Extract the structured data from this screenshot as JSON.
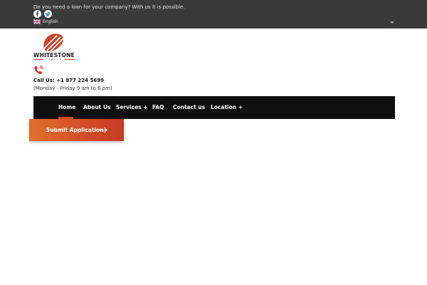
{
  "topbar": {
    "tagline": "Do you need a loan for your company? With us it is possible.",
    "social": [
      {
        "icon": "facebook-icon"
      },
      {
        "icon": "twitter-icon"
      }
    ],
    "language": {
      "flag_icon": "uk-flag-icon",
      "label": "English",
      "chevron_icon": "chevron-down-icon"
    }
  },
  "brand": {
    "logo_text": "WHITESTONE",
    "accent_color": "#d04a22"
  },
  "contact": {
    "call_line": "Call Us: +1 877 224 5699",
    "hours": "(Monday - Friday 9 am to 6 pm)",
    "phone_icon": "phone-icon"
  },
  "nav": {
    "items": [
      {
        "label": "Home",
        "active": true
      },
      {
        "label": "About Us"
      },
      {
        "label": "Services +"
      },
      {
        "label": "FAQ"
      },
      {
        "label": "Contact us"
      },
      {
        "label": "Location +"
      }
    ]
  },
  "cta": {
    "label": "Submit Application",
    "icon": "arrow-right-icon"
  }
}
